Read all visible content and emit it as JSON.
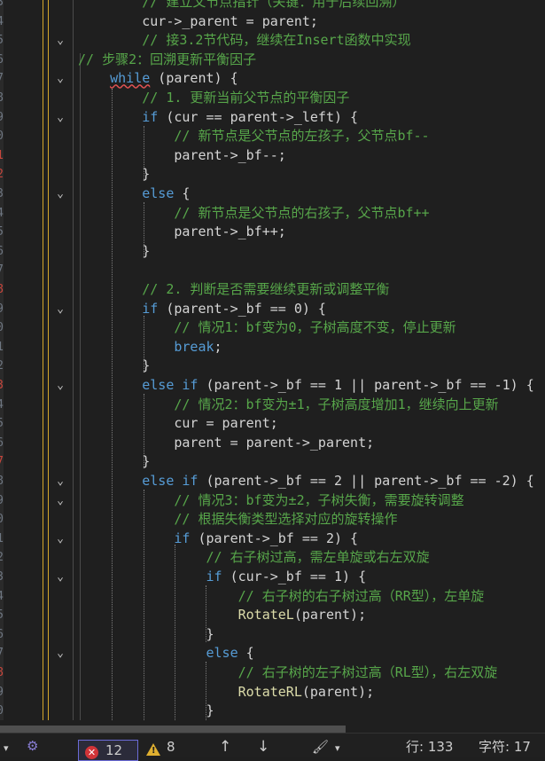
{
  "editor": {
    "line_numbers": [
      "3",
      "4",
      "5",
      "6",
      "7",
      "8",
      "9",
      "0",
      "1",
      "2",
      "3",
      "4",
      "5",
      "6",
      "7",
      "8",
      "9",
      "0",
      "1",
      "2",
      "3",
      "4",
      "5",
      "6",
      "7",
      "8",
      "9",
      "0",
      "1",
      "2",
      "3",
      "4",
      "5",
      "6",
      "7",
      "8",
      "9",
      "0",
      "1"
    ],
    "lines": [
      [
        {
          "t": "        // 建立父节点指针（关键：用于后续回溯）",
          "c": "cm"
        }
      ],
      [
        {
          "t": "        cur->_parent = parent;"
        }
      ],
      [
        {
          "t": "        // 接3.2节代码，继续在Insert函数中实现",
          "c": "cm"
        }
      ],
      [
        {
          "t": "// 步骤2：回溯更新平衡因子",
          "c": "cm"
        }
      ],
      [
        {
          "t": "    "
        },
        {
          "t": "while",
          "c": "kw sq"
        },
        {
          "t": " (parent) {"
        }
      ],
      [
        {
          "t": "        // 1. 更新当前父节点的平衡因子",
          "c": "cm"
        }
      ],
      [
        {
          "t": "        "
        },
        {
          "t": "if",
          "c": "kw"
        },
        {
          "t": " (cur == parent->_left) {"
        }
      ],
      [
        {
          "t": "            // 新节点是父节点的左孩子，父节点bf--",
          "c": "cm"
        }
      ],
      [
        {
          "t": "            parent->_bf--;"
        }
      ],
      [
        {
          "t": "        }"
        }
      ],
      [
        {
          "t": "        "
        },
        {
          "t": "else",
          "c": "kw"
        },
        {
          "t": " {"
        }
      ],
      [
        {
          "t": "            // 新节点是父节点的右孩子，父节点bf++",
          "c": "cm"
        }
      ],
      [
        {
          "t": "            parent->_bf++;"
        }
      ],
      [
        {
          "t": "        }"
        }
      ],
      [
        {
          "t": ""
        }
      ],
      [
        {
          "t": "        // 2. 判断是否需要继续更新或调整平衡",
          "c": "cm"
        }
      ],
      [
        {
          "t": "        "
        },
        {
          "t": "if",
          "c": "kw"
        },
        {
          "t": " (parent->_bf == 0) {"
        }
      ],
      [
        {
          "t": "            // 情况1：bf变为0，子树高度不变，停止更新",
          "c": "cm"
        }
      ],
      [
        {
          "t": "            "
        },
        {
          "t": "break",
          "c": "kw"
        },
        {
          "t": ";"
        }
      ],
      [
        {
          "t": "        }"
        }
      ],
      [
        {
          "t": "        "
        },
        {
          "t": "else if",
          "c": "kw"
        },
        {
          "t": " (parent->_bf == 1 || parent->_bf == -1) {"
        }
      ],
      [
        {
          "t": "            // 情况2：bf变为±1，子树高度增加1，继续向上更新",
          "c": "cm"
        }
      ],
      [
        {
          "t": "            cur = parent;"
        }
      ],
      [
        {
          "t": "            parent = parent->_parent;"
        }
      ],
      [
        {
          "t": "        }"
        }
      ],
      [
        {
          "t": "        "
        },
        {
          "t": "else if",
          "c": "kw"
        },
        {
          "t": " (parent->_bf == 2 || parent->_bf == -2) {"
        }
      ],
      [
        {
          "t": "            // 情况3：bf变为±2，子树失衡，需要旋转调整",
          "c": "cm"
        }
      ],
      [
        {
          "t": "            // 根据失衡类型选择对应的旋转操作",
          "c": "cm"
        }
      ],
      [
        {
          "t": "            "
        },
        {
          "t": "if",
          "c": "kw"
        },
        {
          "t": " (parent->_bf == 2) {"
        }
      ],
      [
        {
          "t": "                // 右子树过高，需左单旋或右左双旋",
          "c": "cm"
        }
      ],
      [
        {
          "t": "                "
        },
        {
          "t": "if",
          "c": "kw"
        },
        {
          "t": " (cur->_bf == 1) {"
        }
      ],
      [
        {
          "t": "                    // 右子树的右子树过高（RR型），左单旋",
          "c": "cm"
        }
      ],
      [
        {
          "t": "                    "
        },
        {
          "t": "RotateL",
          "c": "fn"
        },
        {
          "t": "(parent);"
        }
      ],
      [
        {
          "t": "                }"
        }
      ],
      [
        {
          "t": "                "
        },
        {
          "t": "else",
          "c": "kw"
        },
        {
          "t": " {"
        }
      ],
      [
        {
          "t": "                    // 右子树的左子树过高（RL型），右左双旋",
          "c": "cm"
        }
      ],
      [
        {
          "t": "                    "
        },
        {
          "t": "RotateRL",
          "c": "fn"
        },
        {
          "t": "(parent);"
        }
      ],
      [
        {
          "t": "                }"
        }
      ],
      [
        {
          "t": ""
        }
      ]
    ]
  },
  "status_bar": {
    "errors": "12",
    "warnings": "8",
    "up_arrow": "↑",
    "down_arrow": "↓",
    "line_info": "行: 133",
    "char_info": "字符: 17",
    "colors": {
      "error": "#d13438",
      "warning": "#e0b030",
      "accent": "#d4a72c"
    }
  }
}
